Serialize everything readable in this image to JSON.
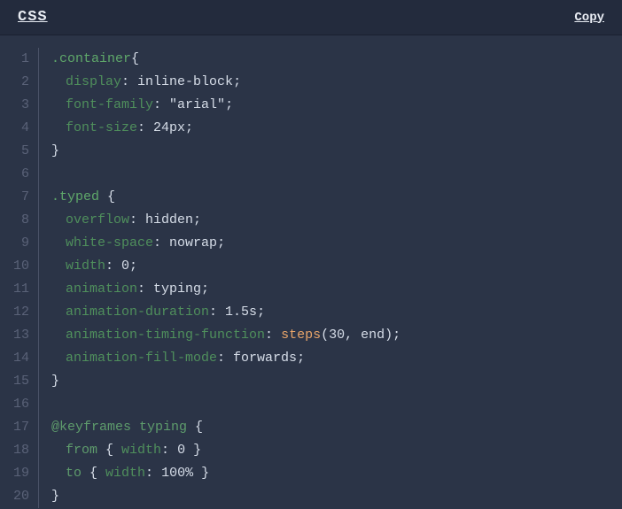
{
  "header": {
    "title": "CSS",
    "copy_label": "Copy"
  },
  "code": {
    "line_count": 20,
    "lines": [
      {
        "n": 1,
        "tokens": [
          {
            "t": ".container",
            "c": "sel"
          },
          {
            "t": "{",
            "c": "punc"
          }
        ]
      },
      {
        "n": 2,
        "indent": 1,
        "tokens": [
          {
            "t": "display",
            "c": "prop"
          },
          {
            "t": ": ",
            "c": "punc"
          },
          {
            "t": "inline-block",
            "c": "val"
          },
          {
            "t": ";",
            "c": "punc"
          }
        ]
      },
      {
        "n": 3,
        "indent": 1,
        "tokens": [
          {
            "t": "font-family",
            "c": "prop"
          },
          {
            "t": ": ",
            "c": "punc"
          },
          {
            "t": "\"arial\"",
            "c": "str"
          },
          {
            "t": ";",
            "c": "punc"
          }
        ]
      },
      {
        "n": 4,
        "indent": 1,
        "tokens": [
          {
            "t": "font-size",
            "c": "prop"
          },
          {
            "t": ": ",
            "c": "punc"
          },
          {
            "t": "24px",
            "c": "num"
          },
          {
            "t": ";",
            "c": "punc"
          }
        ]
      },
      {
        "n": 5,
        "tokens": [
          {
            "t": "}",
            "c": "punc"
          }
        ]
      },
      {
        "n": 6,
        "tokens": []
      },
      {
        "n": 7,
        "tokens": [
          {
            "t": ".typed ",
            "c": "sel"
          },
          {
            "t": "{",
            "c": "punc"
          }
        ]
      },
      {
        "n": 8,
        "indent": 1,
        "tokens": [
          {
            "t": "overflow",
            "c": "prop"
          },
          {
            "t": ": ",
            "c": "punc"
          },
          {
            "t": "hidden",
            "c": "val"
          },
          {
            "t": ";",
            "c": "punc"
          }
        ]
      },
      {
        "n": 9,
        "indent": 1,
        "tokens": [
          {
            "t": "white-space",
            "c": "prop"
          },
          {
            "t": ": ",
            "c": "punc"
          },
          {
            "t": "nowrap",
            "c": "val"
          },
          {
            "t": ";",
            "c": "punc"
          }
        ]
      },
      {
        "n": 10,
        "indent": 1,
        "tokens": [
          {
            "t": "width",
            "c": "prop"
          },
          {
            "t": ": ",
            "c": "punc"
          },
          {
            "t": "0",
            "c": "num"
          },
          {
            "t": ";",
            "c": "punc"
          }
        ]
      },
      {
        "n": 11,
        "indent": 1,
        "tokens": [
          {
            "t": "animation",
            "c": "prop"
          },
          {
            "t": ": ",
            "c": "punc"
          },
          {
            "t": "typing",
            "c": "val"
          },
          {
            "t": ";",
            "c": "punc"
          }
        ]
      },
      {
        "n": 12,
        "indent": 1,
        "tokens": [
          {
            "t": "animation-duration",
            "c": "prop"
          },
          {
            "t": ": ",
            "c": "punc"
          },
          {
            "t": "1.5s",
            "c": "num"
          },
          {
            "t": ";",
            "c": "punc"
          }
        ]
      },
      {
        "n": 13,
        "indent": 1,
        "tokens": [
          {
            "t": "animation-timing-function",
            "c": "prop"
          },
          {
            "t": ": ",
            "c": "punc"
          },
          {
            "t": "steps",
            "c": "fn"
          },
          {
            "t": "(",
            "c": "punc"
          },
          {
            "t": "30",
            "c": "num"
          },
          {
            "t": ", ",
            "c": "punc"
          },
          {
            "t": "end",
            "c": "val"
          },
          {
            "t": ")",
            "c": "punc"
          },
          {
            "t": ";",
            "c": "punc"
          }
        ]
      },
      {
        "n": 14,
        "indent": 1,
        "tokens": [
          {
            "t": "animation-fill-mode",
            "c": "prop"
          },
          {
            "t": ": ",
            "c": "punc"
          },
          {
            "t": "forwards",
            "c": "val"
          },
          {
            "t": ";",
            "c": "punc"
          }
        ]
      },
      {
        "n": 15,
        "tokens": [
          {
            "t": "}",
            "c": "punc"
          }
        ]
      },
      {
        "n": 16,
        "tokens": []
      },
      {
        "n": 17,
        "tokens": [
          {
            "t": "@keyframes typing ",
            "c": "kw"
          },
          {
            "t": "{",
            "c": "punc"
          }
        ]
      },
      {
        "n": 18,
        "indent": 1,
        "tokens": [
          {
            "t": "from ",
            "c": "kw"
          },
          {
            "t": "{ ",
            "c": "punc"
          },
          {
            "t": "width",
            "c": "prop"
          },
          {
            "t": ": ",
            "c": "punc"
          },
          {
            "t": "0",
            "c": "num"
          },
          {
            "t": " }",
            "c": "punc"
          }
        ]
      },
      {
        "n": 19,
        "indent": 1,
        "tokens": [
          {
            "t": "to ",
            "c": "kw"
          },
          {
            "t": "{ ",
            "c": "punc"
          },
          {
            "t": "width",
            "c": "prop"
          },
          {
            "t": ": ",
            "c": "punc"
          },
          {
            "t": "100%",
            "c": "num"
          },
          {
            "t": " }",
            "c": "punc"
          }
        ]
      },
      {
        "n": 20,
        "tokens": [
          {
            "t": "}",
            "c": "punc"
          }
        ]
      }
    ]
  }
}
